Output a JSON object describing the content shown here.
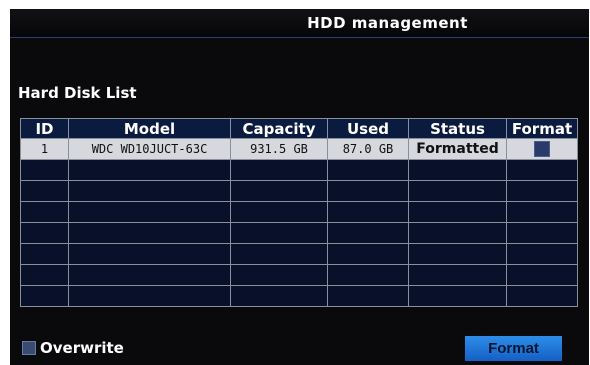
{
  "window": {
    "title": "HDD management"
  },
  "section": {
    "title": "Hard Disk List"
  },
  "table": {
    "columns": [
      "ID",
      "Model",
      "Capacity",
      "Used",
      "Status",
      "Format"
    ],
    "rows": [
      {
        "id": "1",
        "model": "WDC WD10JUCT-63C",
        "capacity": "931.5 GB",
        "used": "87.0 GB",
        "status": "Formatted"
      }
    ]
  },
  "footer": {
    "overwrite_label": "Overwrite",
    "format_button_label": "Format"
  },
  "colors": {
    "background": "#0a0a0c",
    "table_header": "#0b1a3f",
    "empty_row": "#08102a",
    "selected_row": "#d6d8dd",
    "format_button": "#1f78dc"
  }
}
